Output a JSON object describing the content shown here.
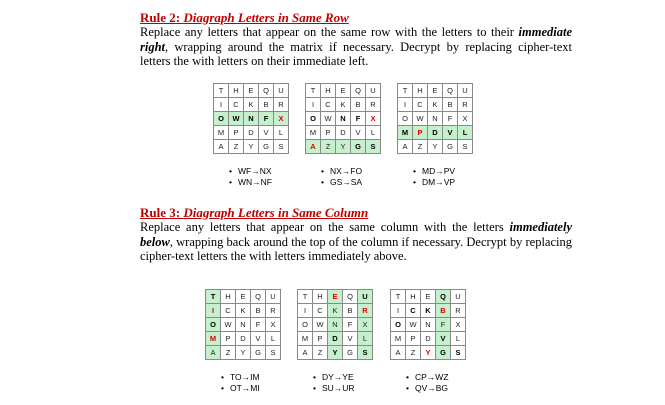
{
  "rule2": {
    "title_prefix": "Rule 2: ",
    "title_italic": "Diagraph Letters in Same Row",
    "text_1": "Replace any letters that appear on the same row with the letters to their ",
    "text_emph_1": "immediate right",
    "text_2": ", wrapping around the matrix if necessary. Decrypt by replacing cipher-text letters the with letters on their immediate left.",
    "examples": [
      [
        "WF→NX",
        "WN→NF"
      ],
      [
        "NX→FO",
        "GS→SA"
      ],
      [
        "MD→PV",
        "DM→VP"
      ]
    ]
  },
  "rule3": {
    "title_prefix": "Rule 3: ",
    "title_italic": "Diagraph Letters in Same Column",
    "text_1": "Replace any letters that appear on the same column with the letters ",
    "text_emph_1": "immediately below",
    "text_2": ", wrapping back around the top of the column if necessary. Decrypt by replacing cipher-text letters the with letters immediately above.",
    "examples": [
      [
        "TO→IM",
        "OT→MI"
      ],
      [
        "DY→YE",
        "SU→UR"
      ],
      [
        "CP→WZ",
        "QV→BG"
      ]
    ]
  },
  "matrix": [
    [
      "T",
      "H",
      "E",
      "Q",
      "U"
    ],
    [
      "I",
      "C",
      "K",
      "B",
      "R"
    ],
    [
      "O",
      "W",
      "N",
      "F",
      "X"
    ],
    [
      "M",
      "P",
      "D",
      "V",
      "L"
    ],
    [
      "A",
      "Z",
      "Y",
      "G",
      "S"
    ]
  ],
  "highlight_color": "#c6efce",
  "title_color": "#c00000"
}
